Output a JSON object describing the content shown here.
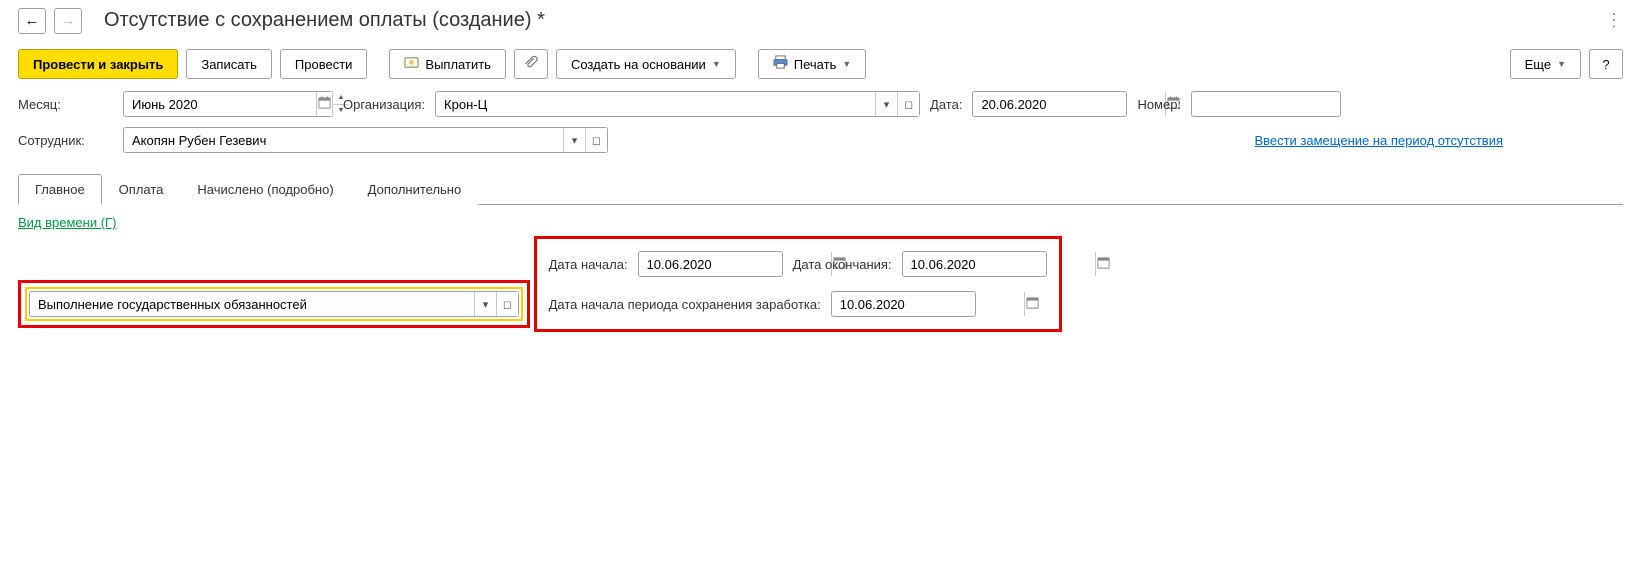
{
  "header": {
    "title": "Отсутствие с сохранением оплаты (создание) *"
  },
  "toolbar": {
    "apply_close": "Провести и закрыть",
    "save": "Записать",
    "apply": "Провести",
    "payout": "Выплатить",
    "create_based": "Создать на основании",
    "print": "Печать",
    "more": "Еще",
    "help": "?"
  },
  "fields": {
    "month_label": "Месяц:",
    "month_value": "Июнь 2020",
    "org_label": "Организация:",
    "org_value": "Крон-Ц",
    "date_label": "Дата:",
    "date_value": "20.06.2020",
    "number_label": "Номер:",
    "number_value": "",
    "employee_label": "Сотрудник:",
    "employee_value": "Акопян Рубен Гезевич",
    "substitute_link": "Ввести замещение на период отсутствия"
  },
  "tabs": {
    "main": "Главное",
    "payment": "Оплата",
    "accrued": "Начислено (подробно)",
    "extra": "Дополнительно"
  },
  "main_tab": {
    "time_type_label": "Вид времени (Г)",
    "time_type_value": "Выполнение государственных обязанностей",
    "start_date_label": "Дата начала:",
    "start_date_value": "10.06.2020",
    "end_date_label": "Дата окончания:",
    "end_date_value": "10.06.2020",
    "earn_start_label": "Дата начала периода сохранения заработка:",
    "earn_start_value": "10.06.2020"
  }
}
